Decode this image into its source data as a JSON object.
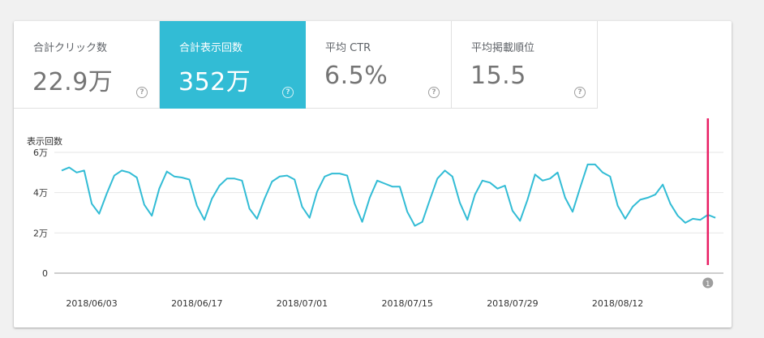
{
  "metrics": [
    {
      "label": "合計クリック数",
      "value": "22.9万",
      "active": false
    },
    {
      "label": "合計表示回数",
      "value": "352万",
      "active": true
    },
    {
      "label": "平均 CTR",
      "value": "6.5%",
      "active": false
    },
    {
      "label": "平均掲載順位",
      "value": "15.5",
      "active": false
    }
  ],
  "help_glyph": "?",
  "chart_data": {
    "type": "line",
    "title": "",
    "ylabel": "表示回数",
    "ylim": [
      0,
      60000
    ],
    "y_ticks": [
      {
        "value": 0,
        "label": "0"
      },
      {
        "value": 20000,
        "label": "2万"
      },
      {
        "value": 40000,
        "label": "4万"
      },
      {
        "value": 60000,
        "label": "6万"
      }
    ],
    "x_start": "2018/05/30",
    "x_ticks": [
      "2018/06/03",
      "2018/06/17",
      "2018/07/01",
      "2018/07/15",
      "2018/07/29",
      "2018/08/12"
    ],
    "series": [
      {
        "name": "",
        "color": "#32bcd5",
        "values": [
          51000,
          52500,
          50000,
          51000,
          34500,
          29500,
          39500,
          48500,
          51000,
          50000,
          47500,
          34000,
          28500,
          42000,
          50500,
          48000,
          47500,
          46500,
          33500,
          26500,
          37000,
          43500,
          47000,
          47000,
          46000,
          32000,
          27000,
          37000,
          45500,
          48000,
          48500,
          46500,
          33000,
          27500,
          40500,
          48000,
          49500,
          49500,
          48500,
          34500,
          25500,
          37500,
          46000,
          44500,
          43000,
          43000,
          30500,
          23500,
          25500,
          36500,
          47000,
          51000,
          48000,
          35000,
          26500,
          39000,
          46000,
          45000,
          42000,
          43500,
          31000,
          26000,
          36500,
          49000,
          46000,
          47000,
          50000,
          37500,
          30500,
          42500,
          54000,
          54000,
          50000,
          48000,
          33500,
          27000,
          33000,
          36500,
          37500,
          39000,
          44000,
          34500,
          28500,
          25000,
          27000,
          26500,
          29000,
          27500
        ]
      }
    ],
    "marker": {
      "date": "2018/08/24",
      "label": "1",
      "color": "#e91e63"
    }
  }
}
